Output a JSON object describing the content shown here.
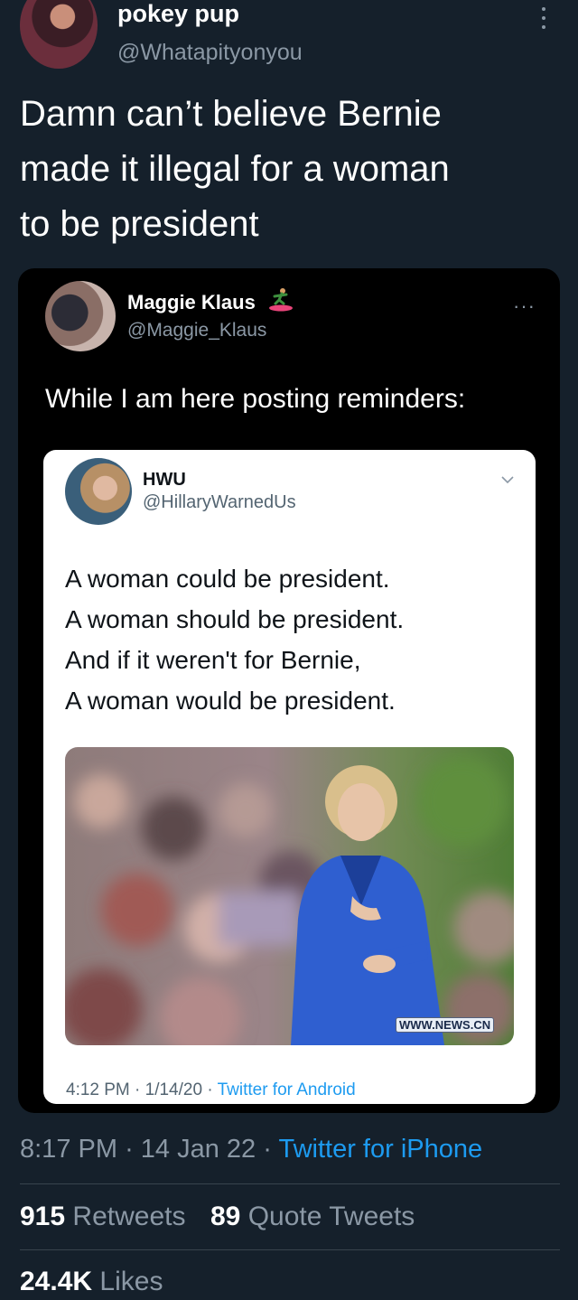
{
  "tweet": {
    "author_name": "pokey pup",
    "author_handle": "@Whatapityonyou",
    "text_lines": [
      "Damn can’t believe Bernie",
      "made it illegal for a woman",
      "to be president"
    ],
    "time": "8:17 PM",
    "date": "14 Jan 22",
    "separator": "·",
    "client": "Twitter for iPhone"
  },
  "quoted": {
    "author_name": "Maggie Klaus",
    "author_handle": "@Maggie_Klaus",
    "more": "···",
    "text": "While I am here posting reminders:"
  },
  "embedded": {
    "author_name": "HWU",
    "author_handle": "@HillaryWarnedUs",
    "lines": [
      "A woman could be president.",
      "A woman should be president.",
      "And if it weren't for Bernie,",
      "A woman would be president."
    ],
    "watermark": "WWW.NEWS.CN",
    "meta": "4:12 PM · 1/14/20 · ",
    "client": "Twitter for Android"
  },
  "stats": {
    "retweets_count": "915",
    "retweets_label": "Retweets",
    "quotes_count": "89",
    "quotes_label": "Quote Tweets",
    "likes_count": "24.4K",
    "likes_label": "Likes"
  },
  "icons": {
    "more_menu": "vertical-dots-icon",
    "surfer": "surfer-emoji-icon",
    "chevron": "chevron-down-icon"
  },
  "colors": {
    "background": "#15202b",
    "card": "#000000",
    "link": "#1d9bf0",
    "muted": "#8b98a5"
  }
}
